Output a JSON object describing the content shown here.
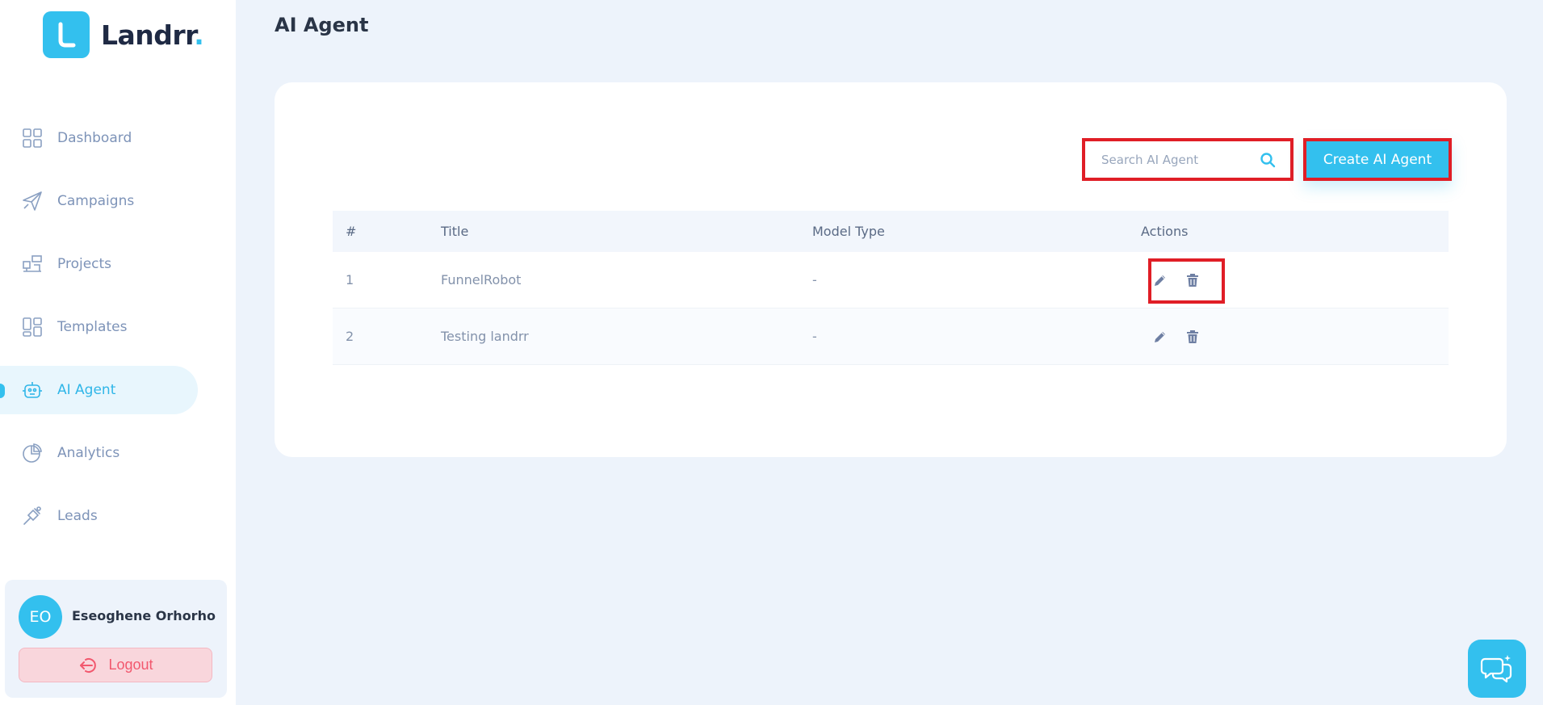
{
  "app": {
    "brand_name": "Landrr",
    "brand_dot": ".",
    "accent_color": "#33c0ee",
    "danger_color": "#e01e26"
  },
  "sidebar": {
    "items": [
      {
        "label": "Dashboard",
        "icon": "grid-icon"
      },
      {
        "label": "Campaigns",
        "icon": "paper-plane-icon"
      },
      {
        "label": "Projects",
        "icon": "projects-icon"
      },
      {
        "label": "Templates",
        "icon": "layout-icon"
      },
      {
        "label": "AI Agent",
        "icon": "robot-icon",
        "active": true
      },
      {
        "label": "Analytics",
        "icon": "pie-chart-icon"
      },
      {
        "label": "Leads",
        "icon": "leads-icon"
      }
    ],
    "user": {
      "initials": "EO",
      "name": "Eseoghene Orhorho"
    },
    "logout_label": "Logout"
  },
  "main": {
    "title": "AI Agent",
    "search": {
      "placeholder": "Search AI Agent",
      "value": ""
    },
    "create_label": "Create AI Agent",
    "table": {
      "headers": [
        "#",
        "Title",
        "Model Type",
        "Actions"
      ],
      "rows": [
        {
          "num": "1",
          "title": "FunnelRobot",
          "model": "-"
        },
        {
          "num": "2",
          "title": "Testing landrr",
          "model": "-"
        }
      ]
    }
  }
}
